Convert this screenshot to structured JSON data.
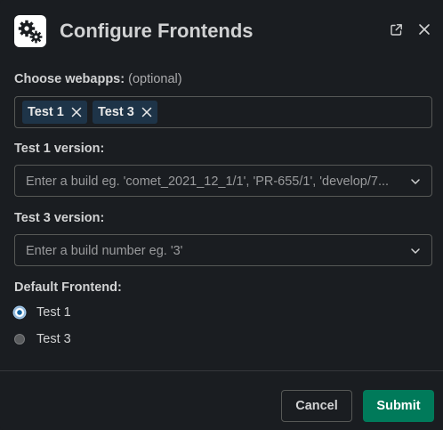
{
  "header": {
    "title": "Configure Frontends",
    "app_icon": "gears-icon",
    "open_external_icon": "open-external-icon",
    "close_icon": "close-icon"
  },
  "webapps": {
    "label": "Choose webapps:",
    "optional_hint": "(optional)",
    "selected": [
      {
        "label": "Test 1"
      },
      {
        "label": "Test 3"
      }
    ]
  },
  "test1_version": {
    "label": "Test 1 version:",
    "placeholder": "Enter a build eg. 'comet_2021_12_1/1', 'PR-655/1', 'develop/7..."
  },
  "test3_version": {
    "label": "Test 3 version:",
    "placeholder": "Enter a build number eg. '3'"
  },
  "default_frontend": {
    "label": "Default Frontend:",
    "options": [
      {
        "label": "Test 1",
        "selected": true
      },
      {
        "label": "Test 3",
        "selected": false
      }
    ]
  },
  "footer": {
    "cancel_label": "Cancel",
    "submit_label": "Submit"
  },
  "colors": {
    "background": "#1a1d21",
    "submit": "#007a5a",
    "chip": "#1e3448",
    "border": "#565856"
  }
}
